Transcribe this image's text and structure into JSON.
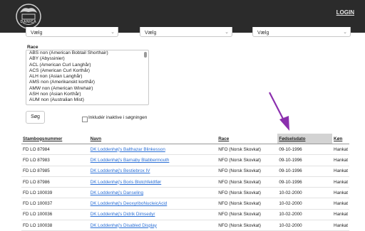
{
  "header": {
    "logo_text": "DANICA",
    "login_label": "LOGIN"
  },
  "filters": {
    "select_1": "Vælg",
    "select_2": "Vælg",
    "select_3": "Vælg",
    "race_label": "Race",
    "race_options": [
      "ABS non (American Bobtail Shorthair)",
      "ABY (Abyssinier)",
      "ACL (American Curl Langhår)",
      "ACS (American Curl Korthår)",
      "ALH non (Asian Langhår)",
      "AMS non (Amerikanskt korthår)",
      "AMW non (American Wirehair)",
      "ASH non (Asian Korthår)",
      "AUM non (Australian Mist)"
    ],
    "search_label": "Søg",
    "inactive_label": "Inkludér inaktive i søgningen"
  },
  "table": {
    "columns": [
      "Stambogsnummer",
      "Navn",
      "Race",
      "Fødselsdato",
      "Køn"
    ],
    "sorted_column": "Fødselsdato",
    "rows": [
      [
        "FD LO 87984",
        "DK Loddenhøj's Balthazar Blinkesson",
        "NFO (Norsk Skovkat)",
        "09-10-1996",
        "Hankat"
      ],
      [
        "FD LO 87983",
        "DK Loddenhøj's Barnaby Blabbermouth",
        "NFO (Norsk Skovkat)",
        "09-10-1996",
        "Hankat"
      ],
      [
        "FD LO 87985",
        "DK Loddenhøj's Bestiebrox IV",
        "NFO (Norsk Skovkat)",
        "09-10-1996",
        "Hankat"
      ],
      [
        "FD LO 87986",
        "DK Loddenhøj's Boris Blotchfeldtfør",
        "NFO (Norsk Skovkat)",
        "09-10-1996",
        "Hankat"
      ],
      [
        "FD LO 100039",
        "DK Loddenhøj's Danseling",
        "NFO (Norsk Skovkat)",
        "10-02-2000",
        "Hankat"
      ],
      [
        "FD LO 100037",
        "DK Loddenhøj's DeoxyriboNucleicAcid",
        "NFO (Norsk Skovkat)",
        "10-02-2000",
        "Hankat"
      ],
      [
        "FD LO 100036",
        "DK Loddenhøj's Didrik Dimsedyr",
        "NFO (Norsk Skovkat)",
        "10-02-2000",
        "Hankat"
      ],
      [
        "FD LO 100038",
        "DK Loddenhøj's Disabled Display",
        "NFO (Norsk Skovkat)",
        "10-02-2000",
        "Hankat"
      ]
    ]
  },
  "colors": {
    "header_bg": "#2b2b2b",
    "link": "#2a6fd6",
    "arrow": "#8b2fae",
    "sorted_header_bg": "#d3d3d3"
  }
}
